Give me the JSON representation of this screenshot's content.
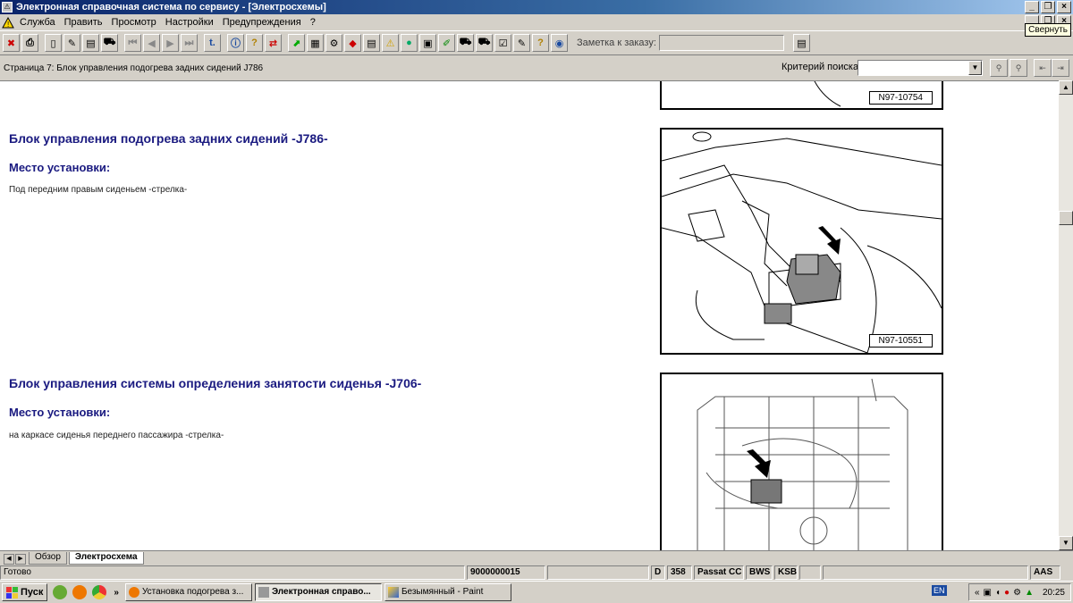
{
  "window": {
    "title": "Электронная справочная система по сервису - [Электросхемы]",
    "tooltip": "Свернуть"
  },
  "menu": [
    "Служба",
    "Править",
    "Просмотр",
    "Настройки",
    "Предупреждения",
    "?"
  ],
  "toolbar": {
    "note_label": "Заметка к заказу:",
    "note_value": ""
  },
  "breadcrumb": "Страница 7: Блок управления подогрева задних сидений J786",
  "search": {
    "label": "Критерий поиска:",
    "value": ""
  },
  "content": {
    "sections": [
      {
        "heading": "Блок управления подогрева задних сидений -J786-",
        "subheading": "Место установки:",
        "text": "Под передним правым сиденьем -стрелка-",
        "figure_label": "N97-10551"
      },
      {
        "heading": "Блок управления системы определения занятости сиденья -J706-",
        "subheading": "Место установки:",
        "text": "на каркасе сиденья переднего пассажира -стрелка-",
        "figure_label": ""
      }
    ],
    "top_figure_label": "N97-10754"
  },
  "tabs": [
    "Обзор",
    "Электросхема"
  ],
  "status": {
    "ready": "Готово",
    "order": "9000000015",
    "d": "D",
    "code": "358",
    "model": "Passat CC",
    "engine": "BWS",
    "gear": "KSB",
    "aas": "AAS"
  },
  "taskbar": {
    "start": "Пуск",
    "chevron": "»",
    "items": [
      {
        "label": "Установка подогрева з..."
      },
      {
        "label": "Электронная справо..."
      },
      {
        "label": "Безымянный - Paint"
      }
    ],
    "lang": "EN",
    "clock": "20:25"
  },
  "colors": {
    "title_gradient_start": "#0a246a",
    "heading": "#1a1a80",
    "chrome": "#d4d0c8"
  }
}
